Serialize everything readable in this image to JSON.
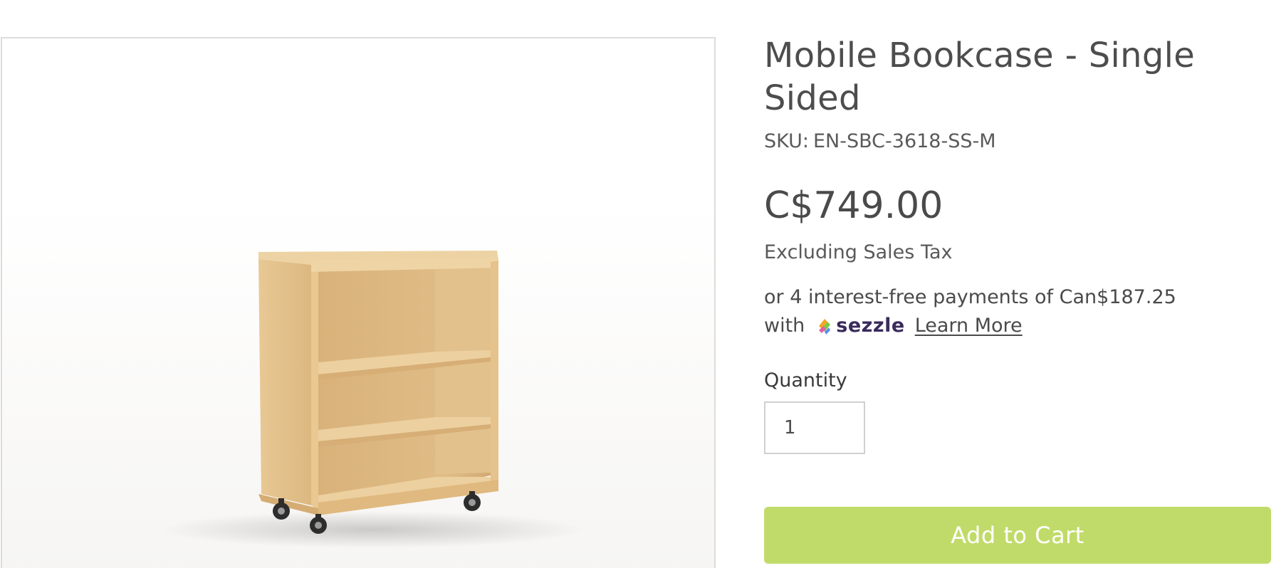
{
  "product": {
    "title": "Mobile Bookcase - Single Sided",
    "sku_label": "SKU:",
    "sku_value": "EN-SBC-3618-SS-M",
    "price": "C$749.00",
    "tax_note": "Excluding Sales Tax",
    "installments_text": "or 4 interest-free payments of Can$187.25",
    "installments_with": "with",
    "sezzle_name": "sezzle",
    "learn_more": "Learn More",
    "image_icon": "bookcase-product-image"
  },
  "quantity": {
    "label": "Quantity",
    "value": "1"
  },
  "cart": {
    "add_label": "Add to Cart"
  },
  "colors": {
    "add_to_cart_bg": "#c1db6a",
    "wood": "#e2bf87",
    "sezzle_text": "#3a2a5c"
  }
}
